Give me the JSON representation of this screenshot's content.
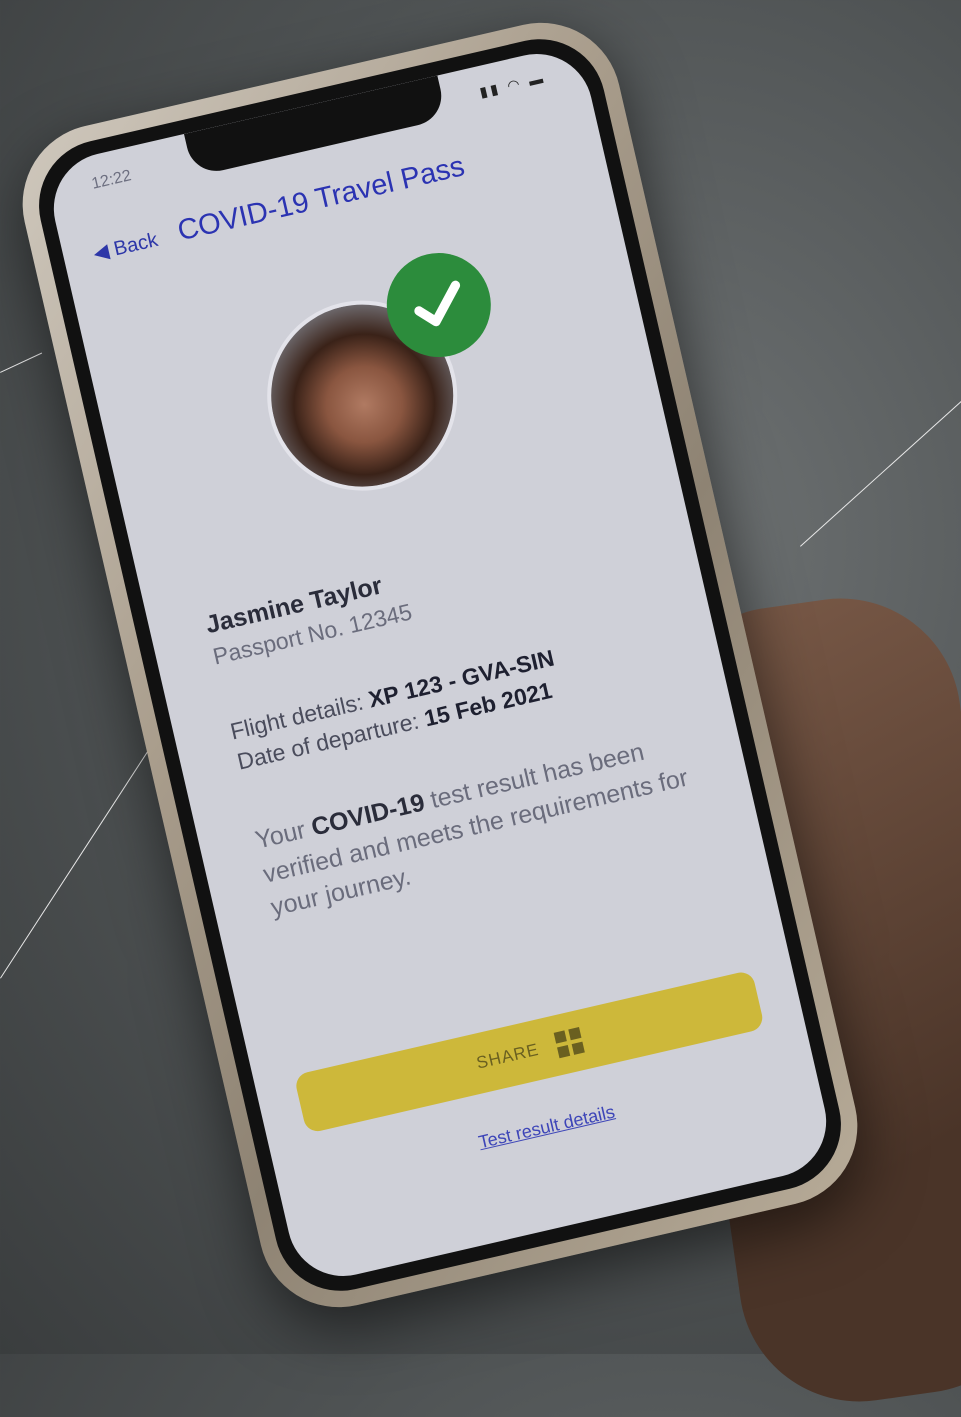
{
  "status_bar": {
    "time": "12:22",
    "icons": "signal-wifi-battery"
  },
  "navbar": {
    "back_label": "Back",
    "title": "COVID-19 Travel Pass"
  },
  "traveler": {
    "name": "Jasmine Taylor",
    "passport": "Passport No. 12345"
  },
  "flight": {
    "details_label": "Flight details:",
    "details_value": "XP 123 - GVA-SIN",
    "departure_label": "Date of departure:",
    "departure_value": "15 Feb 2021"
  },
  "message": {
    "prefix": "Your",
    "highlight": "COVID-19",
    "suffix": "test result has been verified and meets the requirements for your journey."
  },
  "actions": {
    "share_label": "SHARE",
    "details_link": "Test result details"
  },
  "colors": {
    "accent_blue": "#2b33b2",
    "check_green": "#2c8c3c",
    "share_yellow": "#cdb83a"
  }
}
